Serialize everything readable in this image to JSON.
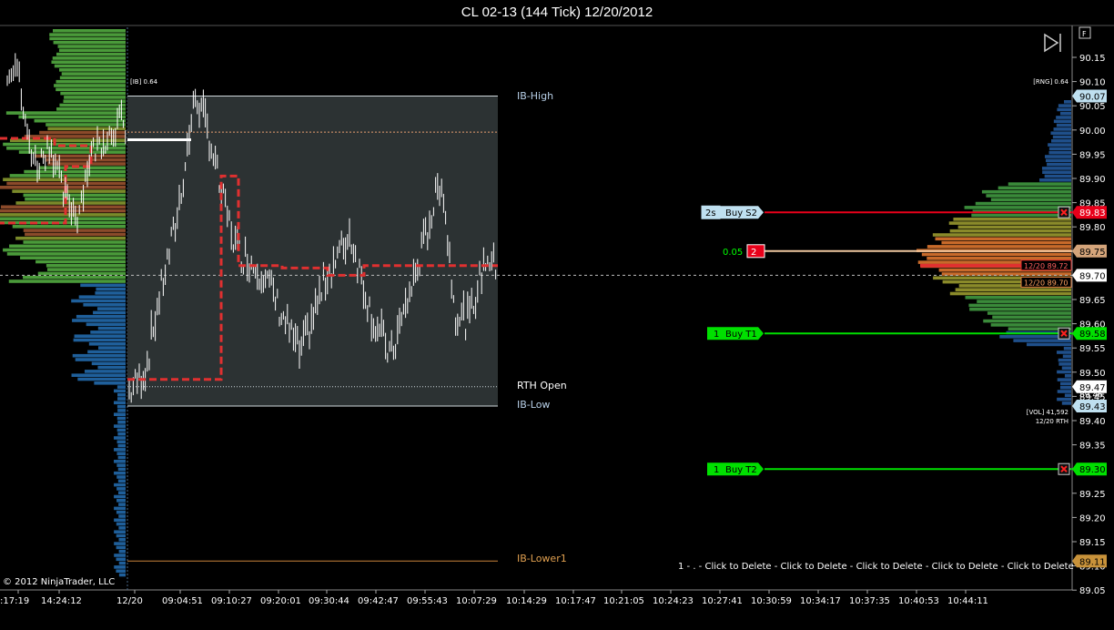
{
  "window": {
    "title": "CL 02-13 (144 Tick)  12/20/2012"
  },
  "copyright": "© 2012 NinjaTrader, LLC",
  "corner_button": "F",
  "overlay_labels": {
    "ib": "[IB] 0.64",
    "rng": "[RNG] 0.64",
    "vol": "[VOL] 41,592",
    "vol_sub": "12/20 RTH"
  },
  "levels": {
    "ib_high": "IB-High",
    "rth_open": "RTH Open",
    "ib_low": "IB-Low",
    "ib_lower1": "IB-Lower1"
  },
  "price_axis": [
    "90.15",
    "90.10",
    "90.05",
    "90.00",
    "89.95",
    "89.90",
    "89.85",
    "89.80",
    "89.75",
    "89.70",
    "89.65",
    "89.60",
    "89.55",
    "89.50",
    "89.45",
    "89.40",
    "89.35",
    "89.30",
    "89.25",
    "89.20",
    "89.15",
    "89.10",
    "89.05"
  ],
  "time_axis": [
    ":17:19",
    "14:24:12",
    "12/20",
    "09:04:51",
    "09:10:27",
    "09:20:01",
    "09:30:44",
    "09:42:47",
    "09:55:43",
    "10:07:29",
    "10:14:29",
    "10:17:47",
    "10:21:05",
    "10:24:23",
    "10:27:41",
    "10:30:59",
    "10:34:17",
    "10:37:35",
    "10:40:53",
    "10:44:11"
  ],
  "price_markers": {
    "ib_high_val": "90.07",
    "s2_val": "89.83",
    "b_val": "89.75",
    "last_val": "89.70",
    "t1_val": "89.58",
    "open_val": "89.47",
    "open_val2": "89.46",
    "ib_low_val": "89.43",
    "t2_val": "89.30",
    "lower1_val": "89.11",
    "tag1": "12/20 89.72",
    "tag2": "12/20 89.70"
  },
  "orders": {
    "s2": {
      "qty": "2s",
      "label": "Buy S2"
    },
    "mid": {
      "offset": "0.05",
      "qty": "2"
    },
    "t1": {
      "qty": "1",
      "label": "Buy T1"
    },
    "t2": {
      "qty": "1",
      "label": "Buy T2"
    }
  },
  "delete_bar": "1 -  . - Click to Delete - Click to Delete - Click to Delete - Click to Delete - Click to Delete",
  "colors": {
    "background": "#000000",
    "ib_box": "#2c3233",
    "red_order": "#e8001a",
    "green_order": "#00e000",
    "profile_line": "#e03030",
    "lower_line": "#c8823a",
    "axis_text": "#ffffff"
  }
}
